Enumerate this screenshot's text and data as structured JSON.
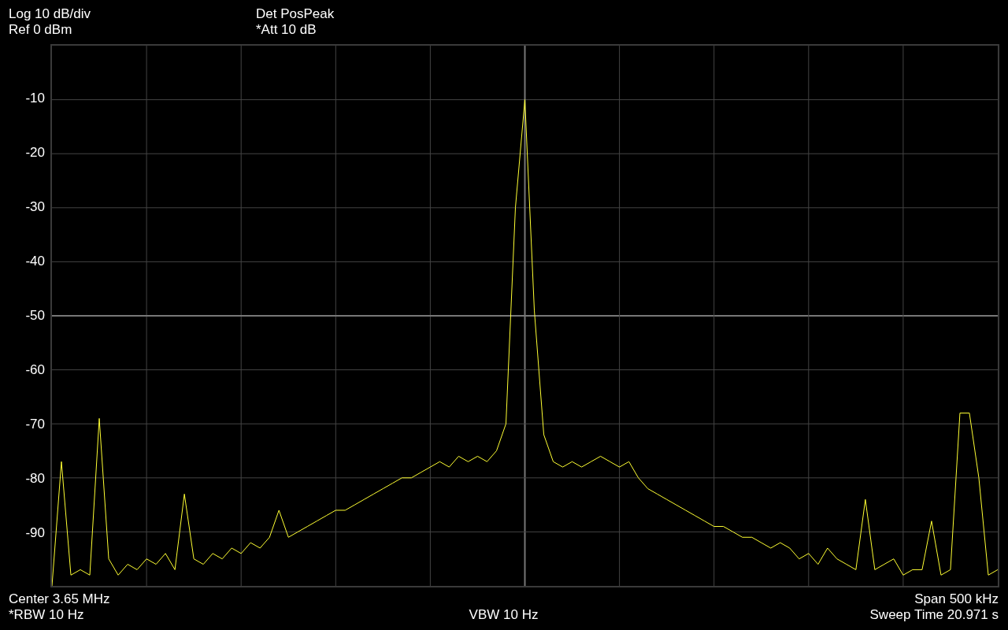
{
  "header": {
    "left": [
      "Log 10 dB/div",
      "Ref 0 dBm"
    ],
    "right": [
      "Det PosPeak",
      "*Att 10 dB"
    ]
  },
  "chart_data": {
    "type": "line",
    "grid": true,
    "ylim": [
      -100,
      0
    ],
    "yticks": [
      {
        "value": -10,
        "label": "-10"
      },
      {
        "value": -20,
        "label": "-20"
      },
      {
        "value": -30,
        "label": "-30"
      },
      {
        "value": -40,
        "label": "-40"
      },
      {
        "value": -50,
        "label": "-50"
      },
      {
        "value": -60,
        "label": "-60"
      },
      {
        "value": -70,
        "label": "-70"
      },
      {
        "value": -80,
        "label": "-80"
      },
      {
        "value": -90,
        "label": "-90"
      }
    ],
    "series": [
      {
        "color": "#ffff33",
        "values": [
          -100,
          -77,
          -98,
          -97,
          -98,
          -69,
          -95,
          -98,
          -96,
          -97,
          -95,
          -96,
          -94,
          -97,
          -83,
          -95,
          -96,
          -94,
          -95,
          -93,
          -94,
          -92,
          -93,
          -91,
          -86,
          -91,
          -90,
          -89,
          -88,
          -87,
          -86,
          -86,
          -85,
          -84,
          -83,
          -82,
          -81,
          -80,
          -80,
          -79,
          -78,
          -77,
          -78,
          -76,
          -77,
          -76,
          -77,
          -75,
          -70,
          -30,
          -10,
          -49,
          -72,
          -77,
          -78,
          -77,
          -78,
          -77,
          -76,
          -77,
          -78,
          -77,
          -80,
          -82,
          -83,
          -84,
          -85,
          -86,
          -87,
          -88,
          -89,
          -89,
          -90,
          -91,
          -91,
          -92,
          -93,
          -92,
          -93,
          -95,
          -94,
          -96,
          -93,
          -95,
          -96,
          -97,
          -84,
          -97,
          -96,
          -95,
          -98,
          -97,
          -97,
          -88,
          -98,
          -97,
          -68,
          -68,
          -80,
          -98,
          -97
        ]
      }
    ]
  },
  "footer": {
    "left": [
      "Center 3.65 MHz",
      "*RBW 10 Hz"
    ],
    "center": [
      "VBW 10 Hz"
    ],
    "right": [
      "Span 500 kHz",
      "Sweep Time 20.971 s"
    ]
  }
}
